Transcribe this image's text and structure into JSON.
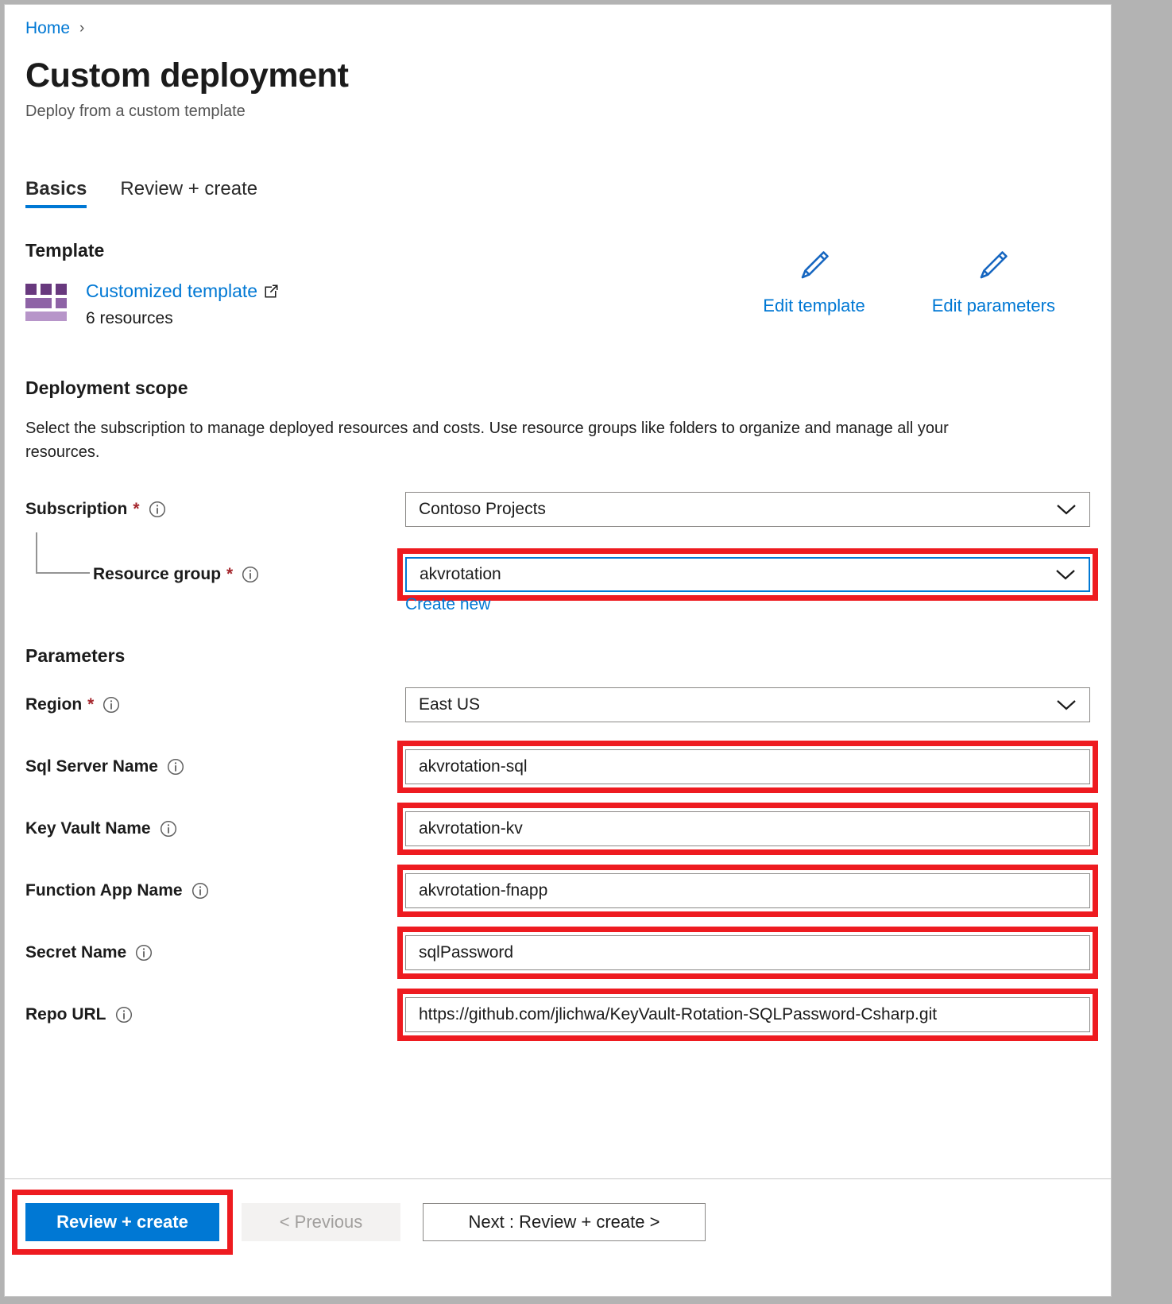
{
  "breadcrumb": {
    "home": "Home",
    "separator": "›"
  },
  "header": {
    "title": "Custom deployment",
    "subtitle": "Deploy from a custom template"
  },
  "tabs": [
    {
      "label": "Basics",
      "active": true
    },
    {
      "label": "Review + create",
      "active": false
    }
  ],
  "template": {
    "heading": "Template",
    "link_label": "Customized template",
    "resources_label": "6 resources",
    "edit_template_label": "Edit template",
    "edit_parameters_label": "Edit parameters"
  },
  "deployment_scope": {
    "heading": "Deployment scope",
    "description": "Select the subscription to manage deployed resources and costs. Use resource groups like folders to organize and manage all your resources.",
    "subscription": {
      "label": "Subscription",
      "required": "*",
      "value": "Contoso Projects"
    },
    "resource_group": {
      "label": "Resource group",
      "required": "*",
      "value": "akvrotation",
      "create_new_label": "Create new"
    }
  },
  "parameters": {
    "heading": "Parameters",
    "region": {
      "label": "Region",
      "required": "*",
      "value": "East US"
    },
    "sql_server_name": {
      "label": "Sql Server Name",
      "value": "akvrotation-sql"
    },
    "key_vault_name": {
      "label": "Key Vault Name",
      "value": "akvrotation-kv"
    },
    "function_app_name": {
      "label": "Function App Name",
      "value": "akvrotation-fnapp"
    },
    "secret_name": {
      "label": "Secret Name",
      "value": "sqlPassword"
    },
    "repo_url": {
      "label": "Repo URL",
      "value": "https://github.com/jlichwa/KeyVault-Rotation-SQLPassword-Csharp.git"
    }
  },
  "footer": {
    "review_create_label": "Review + create",
    "previous_label": "< Previous",
    "next_label": "Next : Review + create >"
  },
  "colors": {
    "accent_blue": "#0078d4",
    "highlight_red": "#ee1b20",
    "required_red": "#a4262c",
    "template_purple": "#68397e"
  }
}
